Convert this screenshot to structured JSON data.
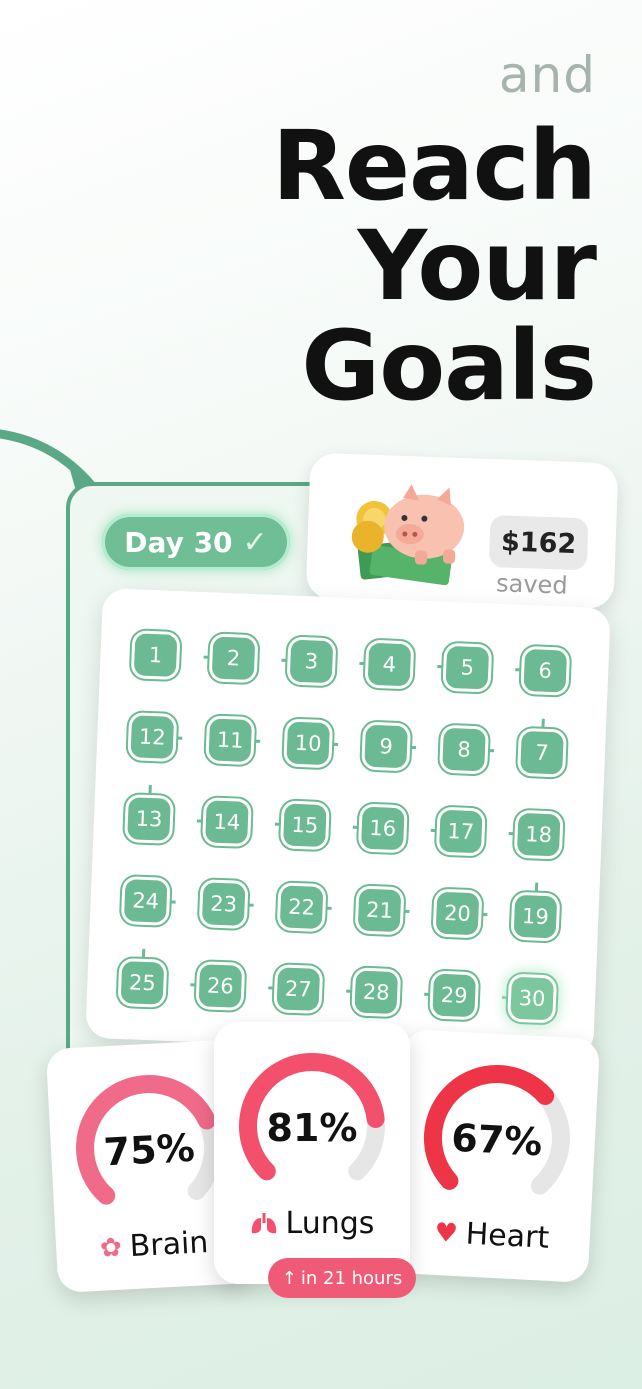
{
  "header": {
    "line1": "and",
    "line2": "Reach",
    "line3": "Your",
    "line4": "Goals"
  },
  "progress": {
    "day_label": "Day 30",
    "check_icon": "check-icon",
    "saved_amount": "$162",
    "saved_label": "saved",
    "piggy_icon": "piggy-bank-icon"
  },
  "day_tiles": [
    "1",
    "2",
    "3",
    "4",
    "5",
    "6",
    "7",
    "8",
    "9",
    "10",
    "11",
    "12",
    "13",
    "14",
    "15",
    "16",
    "17",
    "18",
    "19",
    "20",
    "21",
    "22",
    "23",
    "24",
    "25",
    "26",
    "27",
    "28",
    "29",
    "30"
  ],
  "current_day": "30",
  "organs": [
    {
      "name": "Brain",
      "percent": "75%",
      "value": 0.75,
      "icon": "brain-icon",
      "color": "#f06a8a"
    },
    {
      "name": "Lungs",
      "percent": "81%",
      "value": 0.81,
      "icon": "lungs-icon",
      "color": "#f2506c"
    },
    {
      "name": "Heart",
      "percent": "67%",
      "value": 0.67,
      "icon": "heart-icon",
      "color": "#ee3547"
    }
  ],
  "lungs_badge": {
    "arrow": "↑",
    "text": "in 21 hours"
  },
  "colors": {
    "accent": "#6cba93",
    "text": "#111111",
    "muted": "#a7b4ae"
  }
}
